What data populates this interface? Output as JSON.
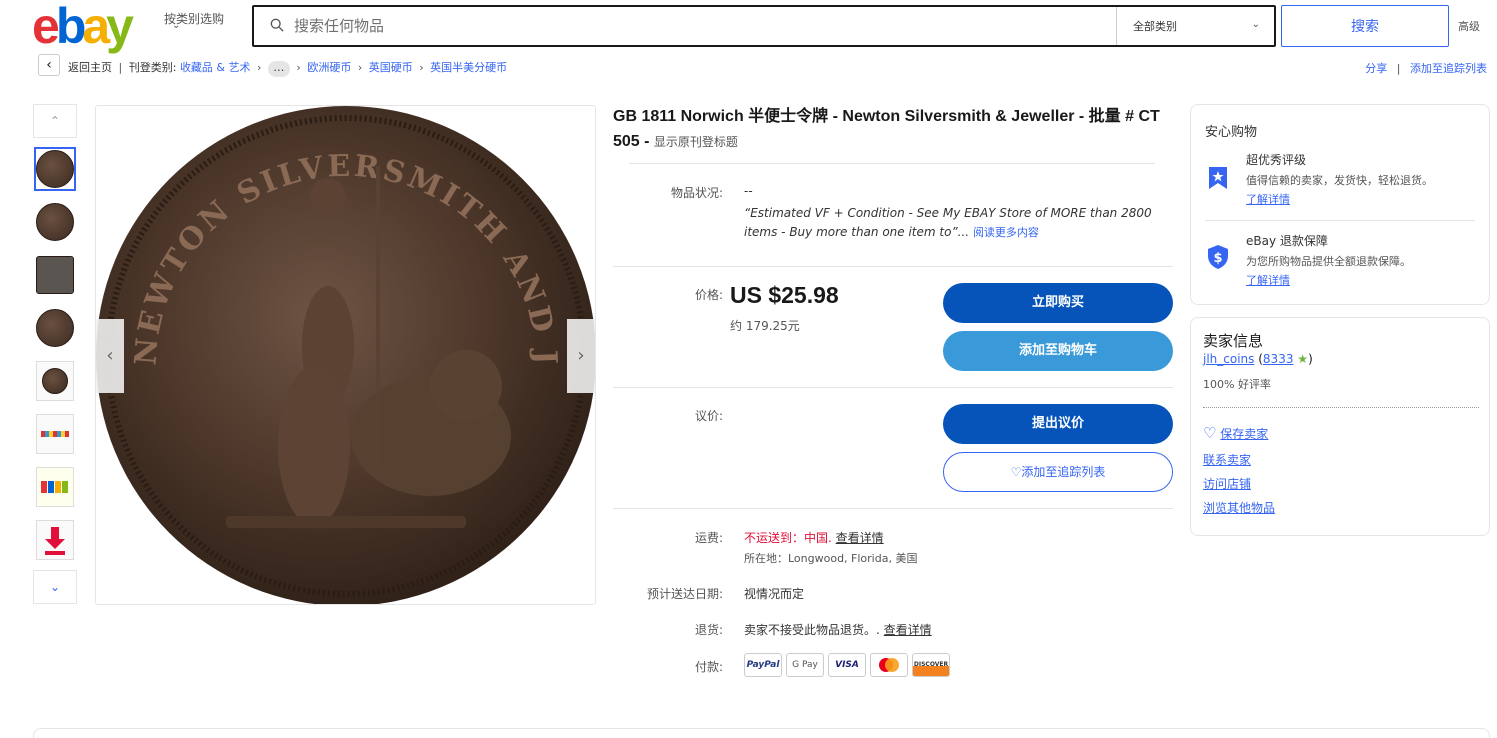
{
  "header": {
    "logo_letters": [
      "e",
      "b",
      "a",
      "y"
    ],
    "shop_by_category": "按类别选购",
    "search_placeholder": "搜索任何物品",
    "category_select": "全部类别",
    "search_button": "搜索",
    "advanced": "高级"
  },
  "breadcrumb": {
    "back": "返回主页",
    "listed_in": "刊登类别:",
    "items": [
      "收藏品 & 艺术",
      "欧洲硬币",
      "英国硬币",
      "英国半美分硬币"
    ],
    "share": "分享",
    "add_watchlist": "添加至追踪列表"
  },
  "gallery": {
    "thumbnail_count": 8,
    "coin_legend_top": "NEWTON SILVERSMITH AND JEWELLER"
  },
  "item": {
    "title": "GB 1811 Norwich 半便士令牌 - Newton Silversmith & Jeweller - 批量 # CT 505 -",
    "show_original": "显示原刊登标题",
    "condition_label": "物品状况:",
    "condition_value": "--",
    "condition_desc": "“Estimated VF + Condition - See My EBAY Store of MORE than 2800 items - Buy more than one item to”...",
    "read_more": "阅读更多内容",
    "price_label": "价格:",
    "price": "US $25.98",
    "price_approx": "约 179.25元",
    "buy_now": "立即购买",
    "add_to_cart": "添加至购物车",
    "offer_label": "议价:",
    "make_offer": "提出议价",
    "add_watch": "添加至追踪列表",
    "shipping_label": "运费:",
    "shipping_value": "不运送到：中国.",
    "see_details": "查看详情",
    "location": "所在地：Longwood, Florida, 美国",
    "delivery_label": "预计送达日期:",
    "delivery_value": "视情况而定",
    "returns_label": "退货:",
    "returns_value": "卖家不接受此物品退货。.",
    "returns_details": "查看详情",
    "payment_label": "付款:",
    "payments": [
      "PayPal",
      "G Pay",
      "VISA",
      "",
      "DISCOVER"
    ]
  },
  "trust": {
    "title": "安心购物",
    "top_rated": "超优秀评级",
    "top_rated_desc": "值得信赖的卖家，发货快，轻松退货。",
    "learn_more": "了解详情",
    "guarantee": "eBay 退款保障",
    "guarantee_desc": "为您所购物品提供全额退款保障。",
    "learn_more2": "了解详情"
  },
  "seller": {
    "title": "卖家信息",
    "name": "jlh_coins",
    "score": "8333",
    "positive": "100% 好评率",
    "save_seller": "保存卖家",
    "contact": "联系卖家",
    "visit_store": "访问店铺",
    "other_items": "浏览其他物品"
  },
  "colors": {
    "accent": "#3665f3",
    "primary_btn": "#0654ba",
    "secondary_btn": "#3a9ad9",
    "error": "#e0103a"
  }
}
